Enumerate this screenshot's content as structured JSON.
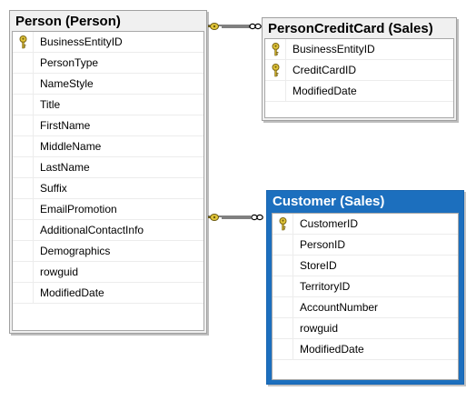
{
  "tables": {
    "person": {
      "title": "Person (Person)",
      "columns": [
        {
          "name": "BusinessEntityID",
          "primary_key": true
        },
        {
          "name": "PersonType",
          "primary_key": false
        },
        {
          "name": "NameStyle",
          "primary_key": false
        },
        {
          "name": "Title",
          "primary_key": false
        },
        {
          "name": "FirstName",
          "primary_key": false
        },
        {
          "name": "MiddleName",
          "primary_key": false
        },
        {
          "name": "LastName",
          "primary_key": false
        },
        {
          "name": "Suffix",
          "primary_key": false
        },
        {
          "name": "EmailPromotion",
          "primary_key": false
        },
        {
          "name": "AdditionalContactInfo",
          "primary_key": false
        },
        {
          "name": "Demographics",
          "primary_key": false
        },
        {
          "name": "rowguid",
          "primary_key": false
        },
        {
          "name": "ModifiedDate",
          "primary_key": false
        }
      ]
    },
    "person_credit_card": {
      "title": "PersonCreditCard (Sales)",
      "columns": [
        {
          "name": "BusinessEntityID",
          "primary_key": true
        },
        {
          "name": "CreditCardID",
          "primary_key": true
        },
        {
          "name": "ModifiedDate",
          "primary_key": false
        }
      ]
    },
    "customer": {
      "title": "Customer (Sales)",
      "selected": true,
      "columns": [
        {
          "name": "CustomerID",
          "primary_key": true
        },
        {
          "name": "PersonID",
          "primary_key": false
        },
        {
          "name": "StoreID",
          "primary_key": false
        },
        {
          "name": "TerritoryID",
          "primary_key": false
        },
        {
          "name": "AccountNumber",
          "primary_key": false
        },
        {
          "name": "rowguid",
          "primary_key": false
        },
        {
          "name": "ModifiedDate",
          "primary_key": false
        }
      ]
    }
  },
  "relationships": [
    {
      "from": "person",
      "to": "person_credit_card",
      "from_end": "key-icon",
      "to_end": "infinity-icon"
    },
    {
      "from": "person",
      "to": "customer",
      "from_end": "key-icon",
      "to_end": "infinity-icon"
    }
  ],
  "colors": {
    "selected_header": "#1c6fbe",
    "table_frame": "#f0f0f0",
    "key_icon": "#e2c63a"
  }
}
